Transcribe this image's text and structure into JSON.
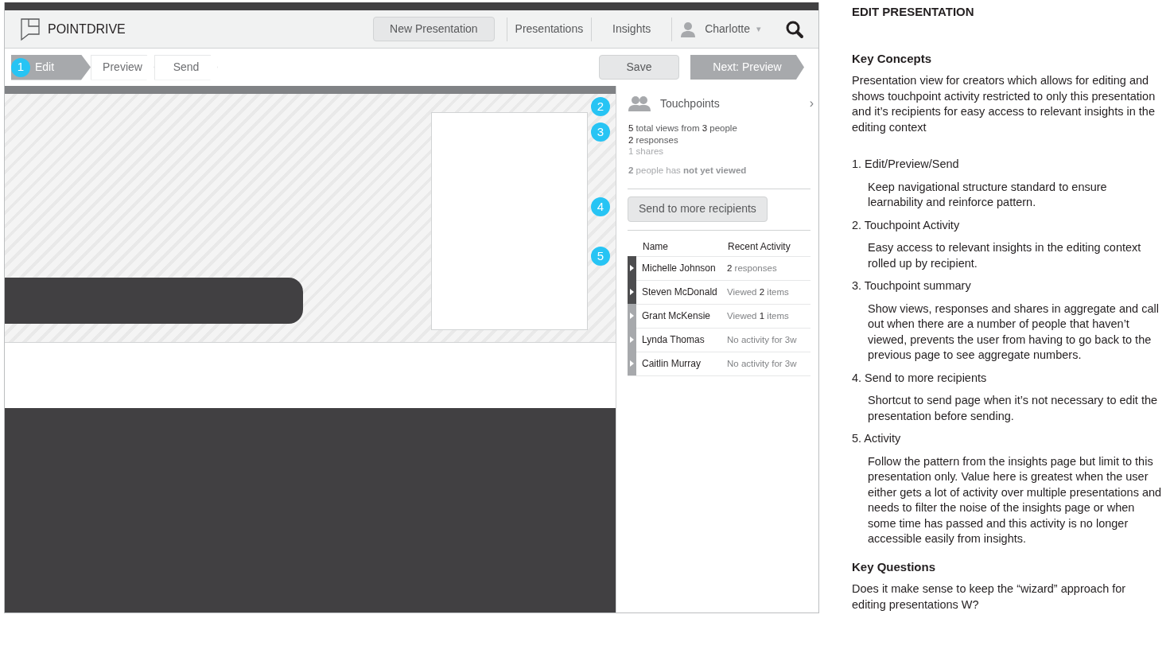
{
  "app": {
    "logo": "POINTDRIVE",
    "new_button": "New Presentation",
    "nav": [
      {
        "label": "Presentations",
        "selected": false
      },
      {
        "label": "Insights",
        "selected": false
      }
    ],
    "user": "Charlotte",
    "caret": "▾",
    "steps": [
      {
        "label": "Edit",
        "selected": true
      },
      {
        "label": "Preview",
        "selected": false
      },
      {
        "label": "Send",
        "selected": false
      }
    ],
    "save": "Save",
    "next": "Next: Preview"
  },
  "callouts": [
    "1",
    "2",
    "3",
    "4",
    "5"
  ],
  "touchpoints": {
    "title": "Touchpoints",
    "chevron": "›",
    "stats": [
      {
        "text": "**5** total views from **3** people",
        "kind": "primary"
      },
      {
        "text": "**2** responses",
        "kind": "primary"
      },
      {
        "text": "1 shares",
        "kind": "muted"
      }
    ],
    "summary": "**2** people has **not yet viewed**",
    "send_button": "Send to more recipients",
    "columns": [
      "Name",
      "Recent Activity"
    ],
    "rows": [
      {
        "name": "Michelle Johnson",
        "activity": "**2** responses",
        "color": "#4d4d4f"
      },
      {
        "name": "Steven McDonald",
        "activity": "Viewed **2** items",
        "color": "#4d4d4f"
      },
      {
        "name": "Grant McKensie",
        "activity": "Viewed **1** items",
        "color": "#a7a9ac"
      },
      {
        "name": "Lynda Thomas",
        "activity": "No activity for 3w",
        "color": "#a7a9ac"
      },
      {
        "name": "Caitlin Murray",
        "activity": "No activity for 3w",
        "color": "#a7a9ac"
      }
    ]
  },
  "notes": {
    "title": "EDIT PRESENTATION",
    "concepts_heading": "Key Concepts",
    "concepts": "Presentation view for creators which allows for editing and shows touchpoint activity restricted to only this presentation and it’s recipients for easy access to relevant insights in the editing context",
    "items": [
      {
        "title": "1. Edit/Preview/Send",
        "body": "Keep navigational structure standard to ensure learnability and reinforce pattern."
      },
      {
        "title": "2. Touchpoint Activity",
        "body": "Easy access to relevant insights in the editing context rolled up by recipient."
      },
      {
        "title": "3. Touchpoint summary",
        "body": "Show views, responses and shares in aggregate and call out when there are a number of people that haven’t viewed, prevents the user from having to go back to the previous page to see aggregate numbers."
      },
      {
        "title": "4. Send to more recipients",
        "body": "Shortcut to send page when it’s not necessary to edit the presentation before sending."
      },
      {
        "title": "5. Activity",
        "body": "Follow the pattern from the insights page but limit to this presentation only.  Value here is greatest when the user either gets a lot of activity over multiple presentations and needs to filter the noise of the insights page or when some time has passed and this activity is no longer accessible easily from insights."
      }
    ],
    "questions_heading": "Key Questions",
    "questions": "Does it make sense to keep the “wizard” approach for editing presentations W?"
  }
}
